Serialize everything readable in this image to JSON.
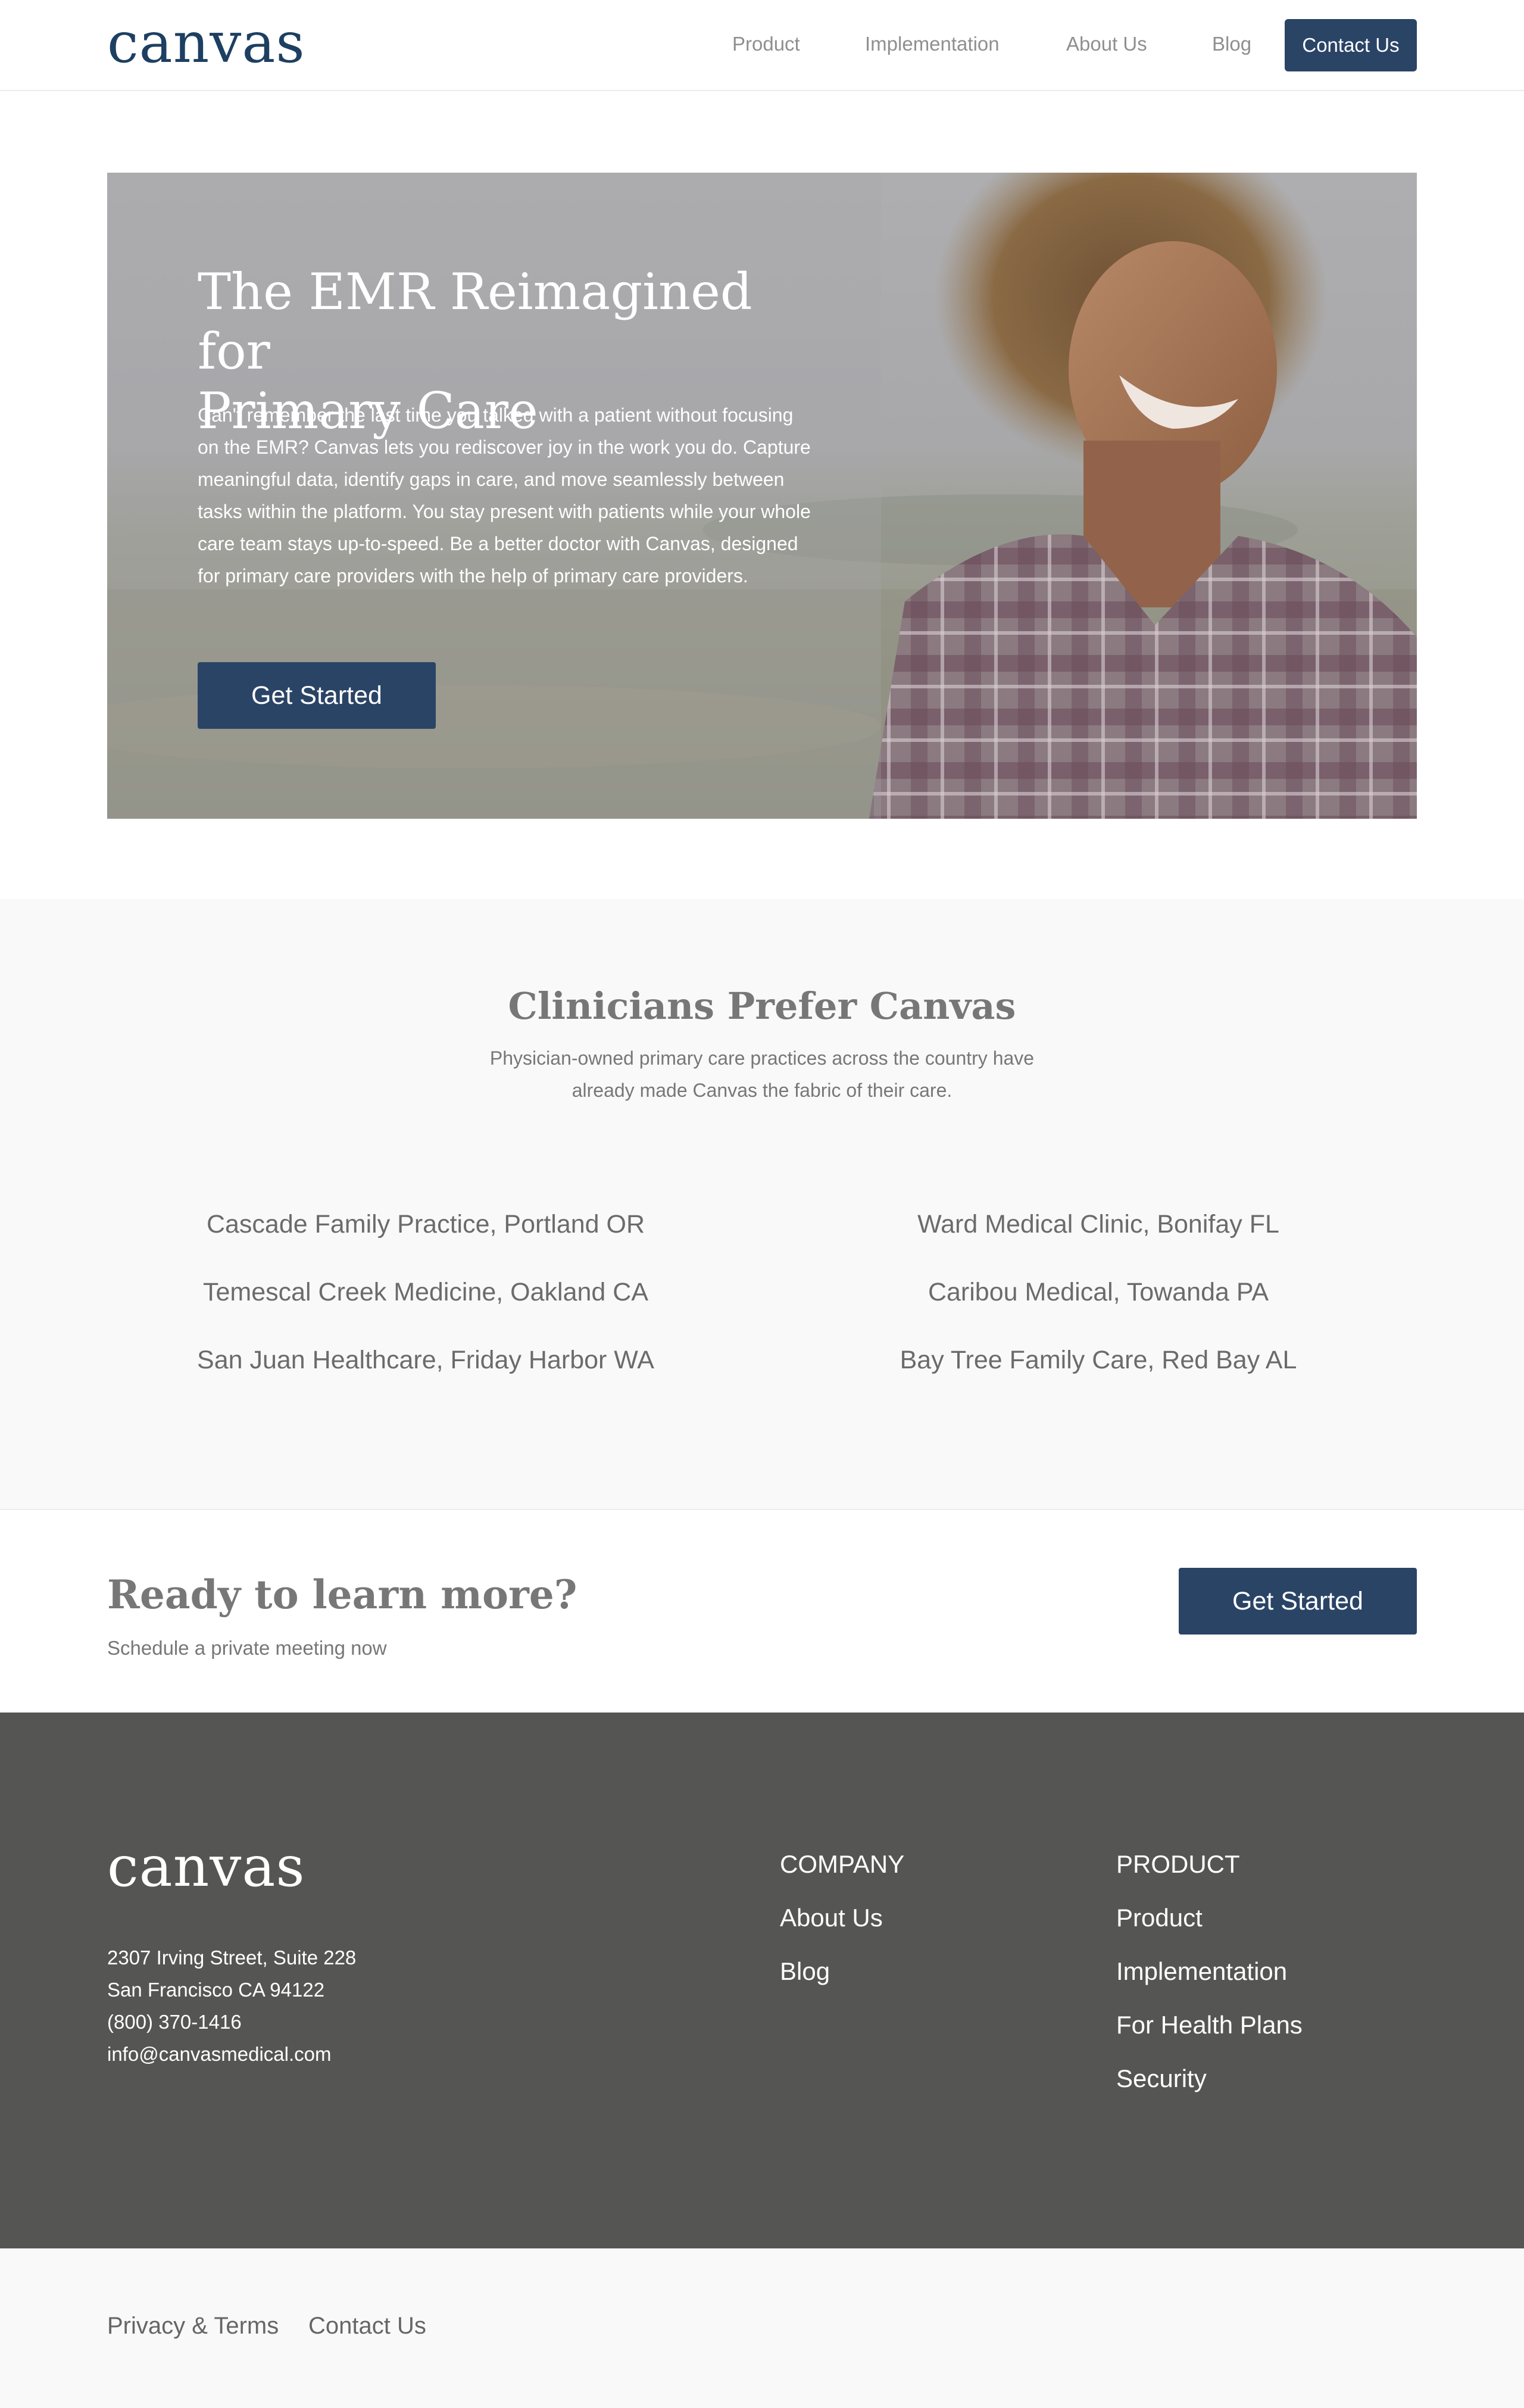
{
  "header": {
    "logo": "canvas",
    "nav": [
      "Product",
      "Implementation",
      "About Us",
      "Blog"
    ],
    "contact_label": "Contact Us"
  },
  "hero": {
    "title_line1": "The EMR Reimagined for",
    "title_line2": "Primary Care",
    "body": "Can't remember the last time you talked with a patient without focusing on the EMR? Canvas lets you rediscover joy in the work you do. Capture meaningful data, identify gaps in care, and move seamlessly between tasks within the platform. You stay present with patients while your whole care team stays up-to-speed. Be a better doctor with Canvas, designed for primary care providers with the help of primary care providers.",
    "cta_label": "Get Started"
  },
  "clinicians": {
    "title": "Clinicians Prefer Canvas",
    "subtitle_line1": "Physician-owned primary care practices across the country have",
    "subtitle_line2": "already made Canvas the fabric of their care.",
    "left": [
      "Cascade Family Practice, Portland OR",
      "Temescal Creek Medicine, Oakland CA",
      "San Juan Healthcare, Friday Harbor WA"
    ],
    "right": [
      "Ward Medical Clinic, Bonifay FL",
      "Caribou Medical, Towanda PA",
      "Bay Tree Family Care, Red Bay AL"
    ]
  },
  "cta": {
    "title": "Ready to learn more?",
    "subtitle": "Schedule a private meeting now",
    "button_label": "Get Started"
  },
  "footer": {
    "logo": "canvas",
    "address": [
      "2307 Irving Street, Suite 228",
      "San Francisco CA 94122",
      "(800) 370-1416",
      "info@canvasmedical.com"
    ],
    "company_heading": "COMPANY",
    "company_links": [
      "About Us",
      "Blog"
    ],
    "product_heading": "PRODUCT",
    "product_links": [
      "Product",
      "Implementation",
      "For Health Plans",
      "Security"
    ]
  },
  "bottom": {
    "links": [
      "Privacy & Terms",
      "Contact Us"
    ]
  }
}
